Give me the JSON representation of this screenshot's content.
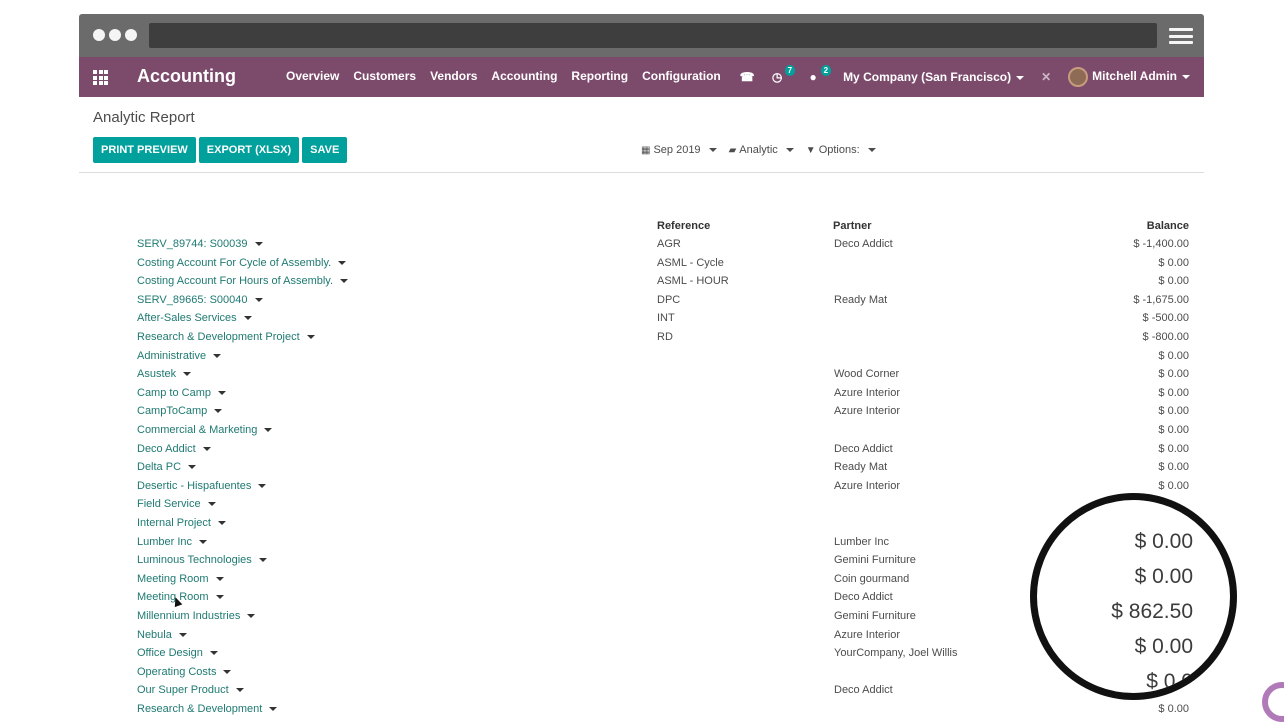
{
  "navbar": {
    "app_title": "Accounting",
    "menu": [
      "Overview",
      "Customers",
      "Vendors",
      "Accounting",
      "Reporting",
      "Configuration"
    ],
    "activity_badge": "7",
    "message_badge": "2",
    "company": "My Company (San Francisco)",
    "user": "Mitchell Admin"
  },
  "page": {
    "breadcrumb": "Analytic Report",
    "buttons": [
      "PRINT PREVIEW",
      "EXPORT (XLSX)",
      "SAVE"
    ],
    "filters": {
      "period": "Sep 2019",
      "analytic": "Analytic",
      "options": "Options:"
    }
  },
  "table": {
    "headers": {
      "reference": "Reference",
      "partner": "Partner",
      "balance": "Balance"
    },
    "rows": [
      {
        "account": "SERV_89744: S00039",
        "reference": "AGR",
        "partner": "Deco Addict",
        "balance": "$ -1,400.00"
      },
      {
        "account": "Costing Account For Cycle of Assembly.",
        "reference": "ASML - Cycle",
        "partner": "",
        "balance": "$ 0.00"
      },
      {
        "account": "Costing Account For Hours of Assembly.",
        "reference": "ASML - HOUR",
        "partner": "",
        "balance": "$ 0.00"
      },
      {
        "account": "SERV_89665: S00040",
        "reference": "DPC",
        "partner": "Ready Mat",
        "balance": "$ -1,675.00"
      },
      {
        "account": "After-Sales Services",
        "reference": "INT",
        "partner": "",
        "balance": "$ -500.00"
      },
      {
        "account": "Research & Development Project",
        "reference": "RD",
        "partner": "",
        "balance": "$ -800.00"
      },
      {
        "account": "Administrative",
        "reference": "",
        "partner": "",
        "balance": "$ 0.00"
      },
      {
        "account": "Asustek",
        "reference": "",
        "partner": "Wood Corner",
        "balance": "$ 0.00"
      },
      {
        "account": "Camp to Camp",
        "reference": "",
        "partner": "Azure Interior",
        "balance": "$ 0.00"
      },
      {
        "account": "CampToCamp",
        "reference": "",
        "partner": "Azure Interior",
        "balance": "$ 0.00"
      },
      {
        "account": "Commercial & Marketing",
        "reference": "",
        "partner": "",
        "balance": "$ 0.00"
      },
      {
        "account": "Deco Addict",
        "reference": "",
        "partner": "Deco Addict",
        "balance": "$ 0.00"
      },
      {
        "account": "Delta PC",
        "reference": "",
        "partner": "Ready Mat",
        "balance": "$ 0.00"
      },
      {
        "account": "Desertic - Hispafuentes",
        "reference": "",
        "partner": "Azure Interior",
        "balance": "$ 0.00"
      },
      {
        "account": "Field Service",
        "reference": "",
        "partner": "",
        "balance": ""
      },
      {
        "account": "Internal Project",
        "reference": "",
        "partner": "",
        "balance": ""
      },
      {
        "account": "Lumber Inc",
        "reference": "",
        "partner": "Lumber Inc",
        "balance": ""
      },
      {
        "account": "Luminous Technologies",
        "reference": "",
        "partner": "Gemini Furniture",
        "balance": ""
      },
      {
        "account": "Meeting Room",
        "reference": "",
        "partner": "Coin gourmand",
        "balance": ""
      },
      {
        "account": "Meeting Room",
        "reference": "",
        "partner": "Deco Addict",
        "balance": ""
      },
      {
        "account": "Millennium Industries",
        "reference": "",
        "partner": "Gemini Furniture",
        "balance": ""
      },
      {
        "account": "Nebula",
        "reference": "",
        "partner": "Azure Interior",
        "balance": ""
      },
      {
        "account": "Office Design",
        "reference": "",
        "partner": "YourCompany, Joel Willis",
        "balance": ""
      },
      {
        "account": "Operating Costs",
        "reference": "",
        "partner": "",
        "balance": ""
      },
      {
        "account": "Our Super Product",
        "reference": "",
        "partner": "Deco Addict",
        "balance": ""
      },
      {
        "account": "Research & Development",
        "reference": "",
        "partner": "",
        "balance": "$ 0.00"
      }
    ]
  },
  "zoom": {
    "values": [
      "$ 0.00",
      "$ 0.00",
      "$ 862.50",
      "$ 0.00",
      "$ 0.0"
    ]
  }
}
